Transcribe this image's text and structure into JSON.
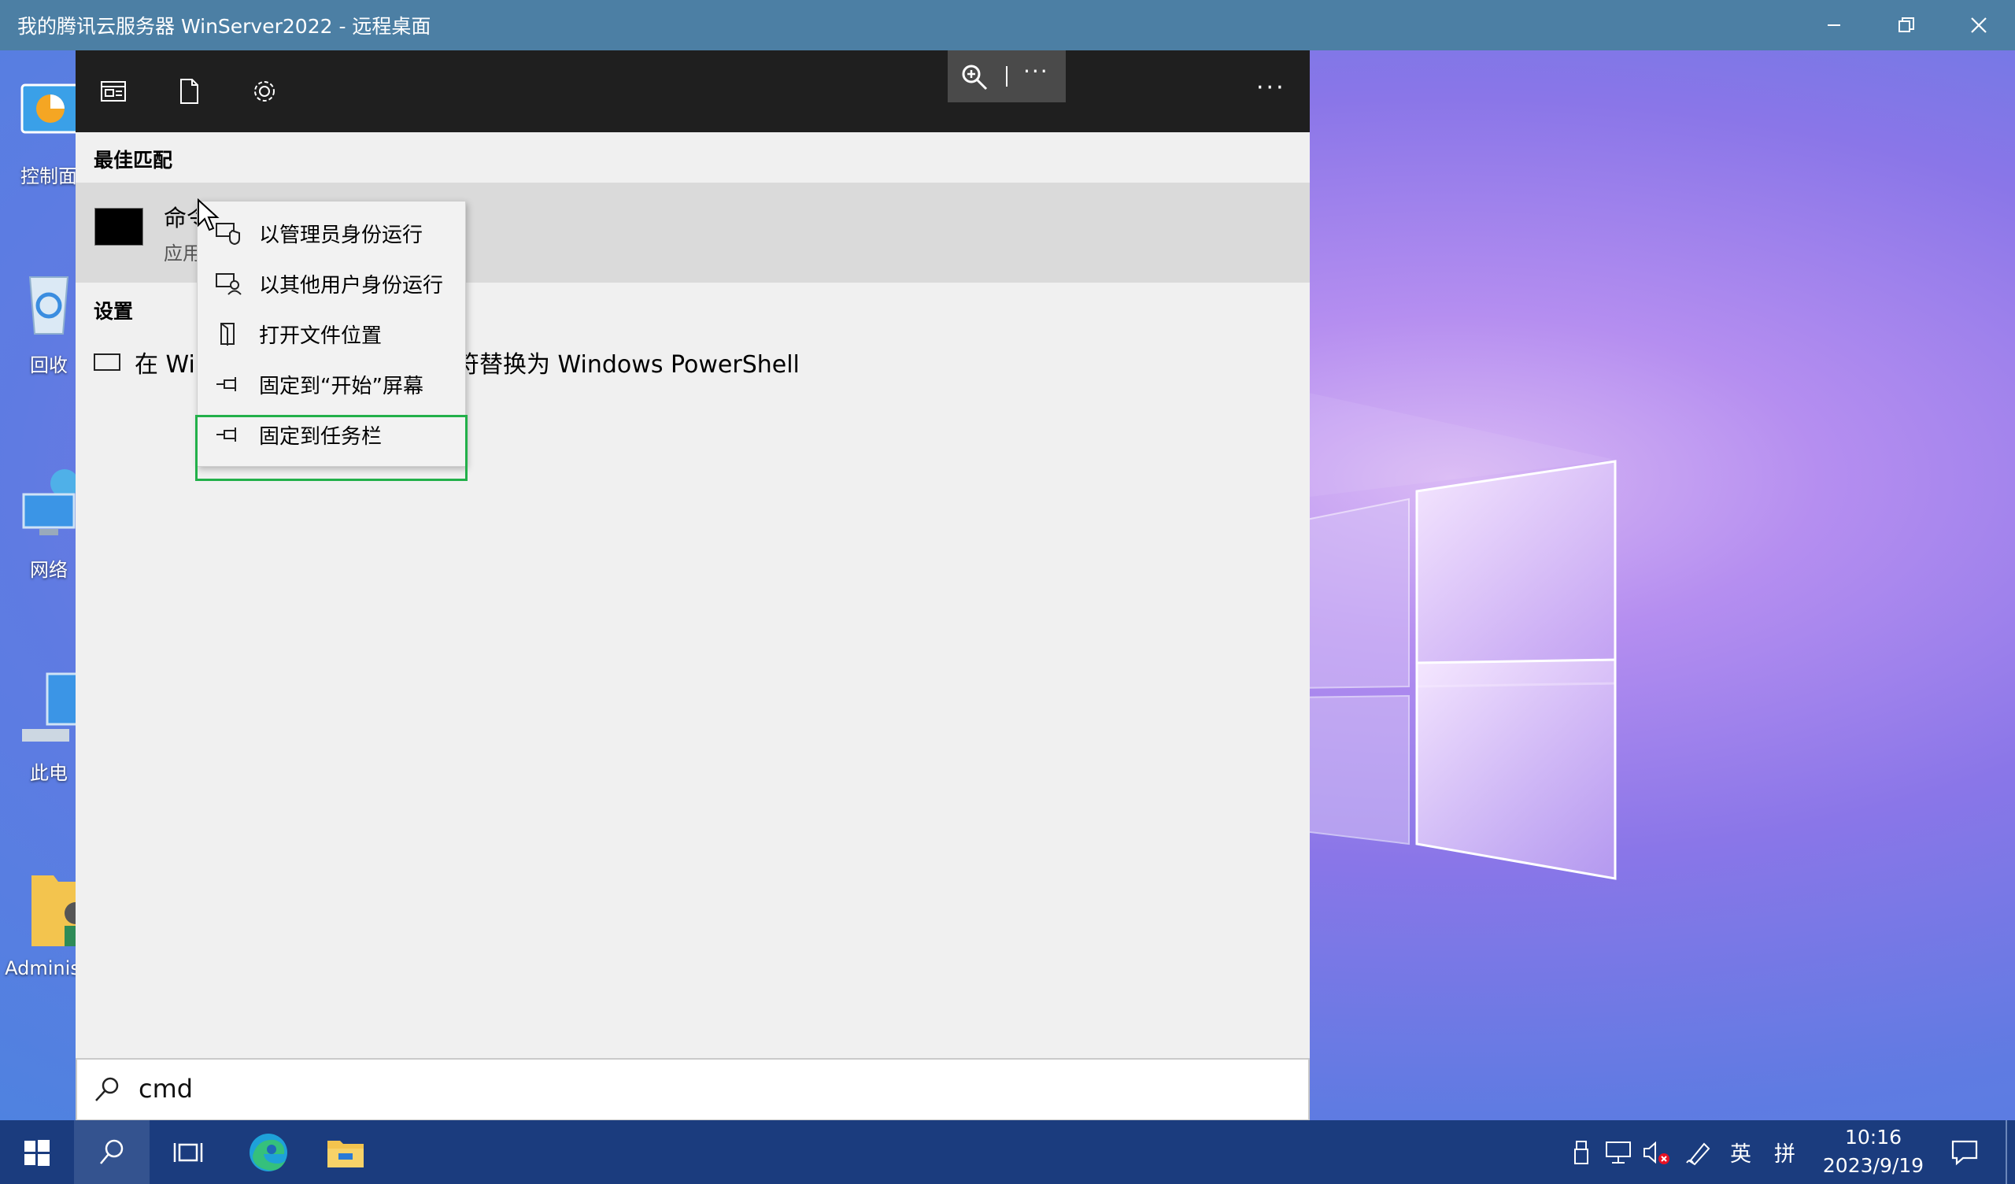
{
  "window": {
    "title": "我的腾讯云服务器 WinServer2022 - 远程桌面",
    "minimize_icon": "minimize-icon",
    "restore_icon": "restore-icon",
    "close_icon": "close-icon"
  },
  "desktop_icons": [
    {
      "label": "控制面",
      "icon": "control-panel-icon"
    },
    {
      "label": "回收",
      "icon": "recycle-bin-icon"
    },
    {
      "label": "网络",
      "icon": "network-icon"
    },
    {
      "label": "此电",
      "icon": "this-pc-icon"
    },
    {
      "label": "Adminis",
      "icon": "user-folder-icon"
    }
  ],
  "start_menu": {
    "top_icons": [
      "documents-list-icon",
      "document-icon",
      "settings-gear-icon"
    ],
    "zoom_more": "···",
    "more": "···",
    "best_match_header": "最佳匹配",
    "best_match": {
      "title": "命令",
      "subtitle": "应用"
    },
    "settings_header": "设置",
    "setting_item": {
      "prefix": "在 Wi",
      "suffix": "符替换为 Windows PowerShell"
    }
  },
  "context_menu": {
    "items": [
      {
        "label": "以管理员身份运行",
        "icon": "run-as-admin-icon"
      },
      {
        "label": "以其他用户身份运行",
        "icon": "run-as-other-user-icon"
      },
      {
        "label": "打开文件位置",
        "icon": "open-file-location-icon"
      },
      {
        "label": "固定到“开始”屏幕",
        "icon": "pin-icon"
      },
      {
        "label": "固定到任务栏",
        "icon": "pin-icon"
      }
    ],
    "highlight_color": "#22b04a"
  },
  "search": {
    "query": "cmd",
    "icon": "search-icon"
  },
  "taskbar": {
    "background": "#1b3c7e",
    "ime_lang": "英",
    "ime_mode": "拼",
    "time": "10:16",
    "date": "2023/9/19"
  }
}
